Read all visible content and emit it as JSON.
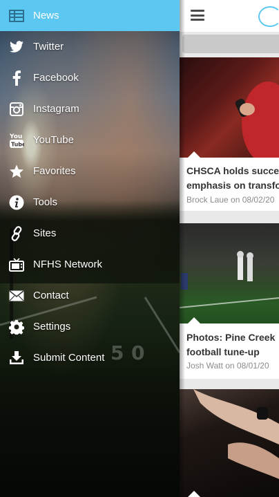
{
  "drawer": {
    "items": [
      {
        "label": "News",
        "icon": "news-grid-icon",
        "active": true
      },
      {
        "label": "Twitter",
        "icon": "twitter-icon"
      },
      {
        "label": "Facebook",
        "icon": "facebook-icon"
      },
      {
        "label": "Instagram",
        "icon": "instagram-icon"
      },
      {
        "label": "YouTube",
        "icon": "youtube-icon"
      },
      {
        "label": "Favorites",
        "icon": "star-icon"
      },
      {
        "label": "Tools",
        "icon": "info-icon"
      },
      {
        "label": "Sites",
        "icon": "link-icon"
      },
      {
        "label": "NFHS Network",
        "icon": "tv-icon"
      },
      {
        "label": "Contact",
        "icon": "envelope-icon"
      },
      {
        "label": "Settings",
        "icon": "gear-icon"
      },
      {
        "label": "Submit Content",
        "icon": "download-icon"
      }
    ],
    "active_color": "#5cc8f2"
  },
  "main": {
    "articles": [
      {
        "headline_line1": "CHSCA holds succe",
        "headline_line2": "emphasis on transfo",
        "byline": "Brock Laue on 08/02/20"
      },
      {
        "headline_line1": "Photos: Pine Creek",
        "headline_line2": "football tune-up",
        "byline": "Josh Watt on 08/01/20"
      },
      {
        "headline_line1": "",
        "headline_line2": "",
        "byline": ""
      }
    ]
  },
  "colors": {
    "accent": "#5cc8f2",
    "menu_text": "#ffffff",
    "headline": "#333333",
    "byline": "#8a8a8a"
  }
}
